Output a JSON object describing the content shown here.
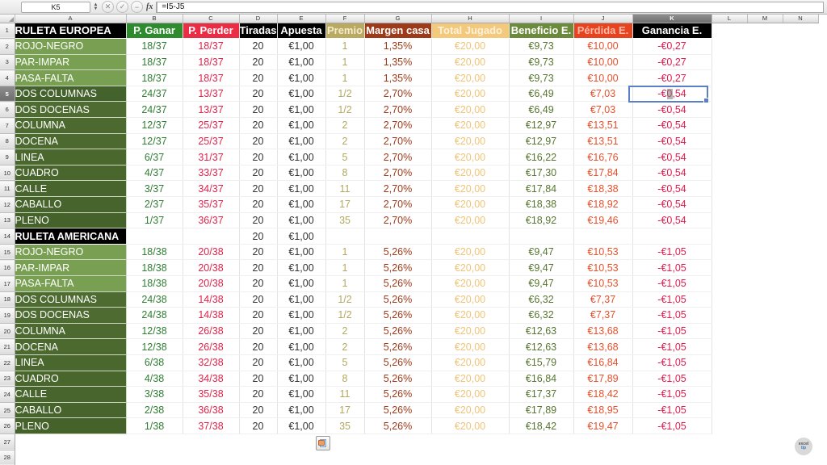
{
  "formula_bar": {
    "name_box_value": "K5",
    "formula_value": "=I5-J5",
    "cancel_icon": "cancel-icon",
    "accept_icon": "accept-icon",
    "function_icon": "function-icon",
    "fx_label": "fx"
  },
  "columns": {
    "letters": [
      "A",
      "B",
      "C",
      "D",
      "E",
      "F",
      "G",
      "H",
      "I",
      "J",
      "K",
      "L",
      "M",
      "N"
    ],
    "selected_letter": "K"
  },
  "rows": {
    "numbers": [
      "1",
      "2",
      "3",
      "4",
      "5",
      "6",
      "7",
      "8",
      "9",
      "10",
      "11",
      "12",
      "13",
      "14",
      "15",
      "16",
      "17",
      "18",
      "19",
      "20",
      "21",
      "22",
      "23",
      "24",
      "25",
      "26",
      "27",
      "28"
    ],
    "selected_number": "5"
  },
  "header": {
    "name": "RULETA EUROPEA",
    "p_ganar": "P. Ganar",
    "p_perder": "P. Perder",
    "tiradas": "Tiradas",
    "apuesta": "Apuesta",
    "premio": "Premio",
    "margen": "Margen casa",
    "total": "Total Jugado",
    "beneficio": "Beneficio E.",
    "perdida": "Pérdida E.",
    "ganancia": "Ganancia E."
  },
  "section_americana": {
    "title": "RULETA AMERICANA",
    "tiradas": "20",
    "apuesta": "€1,00"
  },
  "chart_data": {
    "type": "table",
    "title": "RULETA EUROPEA / RULETA AMERICANA",
    "columns": [
      "RULETA EUROPEA",
      "P. Ganar",
      "P. Perder",
      "Tiradas",
      "Apuesta",
      "Premio",
      "Margen casa",
      "Total Jugado",
      "Beneficio E.",
      "Pérdida E.",
      "Ganancia E."
    ],
    "europea": [
      {
        "row": "2",
        "name": "ROJO-NEGRO",
        "ganar": "18/37",
        "perder": "18/37",
        "tiradas": "20",
        "apuesta": "€1,00",
        "premio": "1",
        "margen": "1,35%",
        "total": "€20,00",
        "beneficio": "€9,73",
        "perdida": "€10,00",
        "ganancia": "-€0,27"
      },
      {
        "row": "3",
        "name": "PAR-IMPAR",
        "ganar": "18/37",
        "perder": "18/37",
        "tiradas": "20",
        "apuesta": "€1,00",
        "premio": "1",
        "margen": "1,35%",
        "total": "€20,00",
        "beneficio": "€9,73",
        "perdida": "€10,00",
        "ganancia": "-€0,27"
      },
      {
        "row": "4",
        "name": "PASA-FALTA",
        "ganar": "18/37",
        "perder": "18/37",
        "tiradas": "20",
        "apuesta": "€1,00",
        "premio": "1",
        "margen": "1,35%",
        "total": "€20,00",
        "beneficio": "€9,73",
        "perdida": "€10,00",
        "ganancia": "-€0,27"
      },
      {
        "row": "5",
        "name": "DOS COLUMNAS",
        "ganar": "24/37",
        "perder": "13/37",
        "tiradas": "20",
        "apuesta": "€1,00",
        "premio": "1/2",
        "margen": "2,70%",
        "total": "€20,00",
        "beneficio": "€6,49",
        "perdida": "€7,03",
        "ganancia": "-€0,54"
      },
      {
        "row": "6",
        "name": "DOS DOCENAS",
        "ganar": "24/37",
        "perder": "13/37",
        "tiradas": "20",
        "apuesta": "€1,00",
        "premio": "1/2",
        "margen": "2,70%",
        "total": "€20,00",
        "beneficio": "€6,49",
        "perdida": "€7,03",
        "ganancia": "-€0,54"
      },
      {
        "row": "7",
        "name": "COLUMNA",
        "ganar": "12/37",
        "perder": "25/37",
        "tiradas": "20",
        "apuesta": "€1,00",
        "premio": "2",
        "margen": "2,70%",
        "total": "€20,00",
        "beneficio": "€12,97",
        "perdida": "€13,51",
        "ganancia": "-€0,54"
      },
      {
        "row": "8",
        "name": "DOCENA",
        "ganar": "12/37",
        "perder": "25/37",
        "tiradas": "20",
        "apuesta": "€1,00",
        "premio": "2",
        "margen": "2,70%",
        "total": "€20,00",
        "beneficio": "€12,97",
        "perdida": "€13,51",
        "ganancia": "-€0,54"
      },
      {
        "row": "9",
        "name": "LINEA",
        "ganar": "6/37",
        "perder": "31/37",
        "tiradas": "20",
        "apuesta": "€1,00",
        "premio": "5",
        "margen": "2,70%",
        "total": "€20,00",
        "beneficio": "€16,22",
        "perdida": "€16,76",
        "ganancia": "-€0,54"
      },
      {
        "row": "10",
        "name": "CUADRO",
        "ganar": "4/37",
        "perder": "33/37",
        "tiradas": "20",
        "apuesta": "€1,00",
        "premio": "8",
        "margen": "2,70%",
        "total": "€20,00",
        "beneficio": "€17,30",
        "perdida": "€17,84",
        "ganancia": "-€0,54"
      },
      {
        "row": "11",
        "name": "CALLE",
        "ganar": "3/37",
        "perder": "34/37",
        "tiradas": "20",
        "apuesta": "€1,00",
        "premio": "11",
        "margen": "2,70%",
        "total": "€20,00",
        "beneficio": "€17,84",
        "perdida": "€18,38",
        "ganancia": "-€0,54"
      },
      {
        "row": "12",
        "name": "CABALLO",
        "ganar": "2/37",
        "perder": "35/37",
        "tiradas": "20",
        "apuesta": "€1,00",
        "premio": "17",
        "margen": "2,70%",
        "total": "€20,00",
        "beneficio": "€18,38",
        "perdida": "€18,92",
        "ganancia": "-€0,54"
      },
      {
        "row": "13",
        "name": "PLENO",
        "ganar": "1/37",
        "perder": "36/37",
        "tiradas": "20",
        "apuesta": "€1,00",
        "premio": "35",
        "margen": "2,70%",
        "total": "€20,00",
        "beneficio": "€18,92",
        "perdida": "€19,46",
        "ganancia": "-€0,54"
      }
    ],
    "americana": [
      {
        "row": "15",
        "name": "ROJO-NEGRO",
        "ganar": "18/38",
        "perder": "20/38",
        "tiradas": "20",
        "apuesta": "€1,00",
        "premio": "1",
        "margen": "5,26%",
        "total": "€20,00",
        "beneficio": "€9,47",
        "perdida": "€10,53",
        "ganancia": "-€1,05"
      },
      {
        "row": "16",
        "name": "PAR-IMPAR",
        "ganar": "18/38",
        "perder": "20/38",
        "tiradas": "20",
        "apuesta": "€1,00",
        "premio": "1",
        "margen": "5,26%",
        "total": "€20,00",
        "beneficio": "€9,47",
        "perdida": "€10,53",
        "ganancia": "-€1,05"
      },
      {
        "row": "17",
        "name": "PASA-FALTA",
        "ganar": "18/38",
        "perder": "20/38",
        "tiradas": "20",
        "apuesta": "€1,00",
        "premio": "1",
        "margen": "5,26%",
        "total": "€20,00",
        "beneficio": "€9,47",
        "perdida": "€10,53",
        "ganancia": "-€1,05"
      },
      {
        "row": "18",
        "name": "DOS COLUMNAS",
        "ganar": "24/38",
        "perder": "14/38",
        "tiradas": "20",
        "apuesta": "€1,00",
        "premio": "1/2",
        "margen": "5,26%",
        "total": "€20,00",
        "beneficio": "€6,32",
        "perdida": "€7,37",
        "ganancia": "-€1,05"
      },
      {
        "row": "19",
        "name": "DOS DOCENAS",
        "ganar": "24/38",
        "perder": "14/38",
        "tiradas": "20",
        "apuesta": "€1,00",
        "premio": "1/2",
        "margen": "5,26%",
        "total": "€20,00",
        "beneficio": "€6,32",
        "perdida": "€7,37",
        "ganancia": "-€1,05"
      },
      {
        "row": "20",
        "name": "COLUMNA",
        "ganar": "12/38",
        "perder": "26/38",
        "tiradas": "20",
        "apuesta": "€1,00",
        "premio": "2",
        "margen": "5,26%",
        "total": "€20,00",
        "beneficio": "€12,63",
        "perdida": "€13,68",
        "ganancia": "-€1,05"
      },
      {
        "row": "21",
        "name": "DOCENA",
        "ganar": "12/38",
        "perder": "26/38",
        "tiradas": "20",
        "apuesta": "€1,00",
        "premio": "2",
        "margen": "5,26%",
        "total": "€20,00",
        "beneficio": "€12,63",
        "perdida": "€13,68",
        "ganancia": "-€1,05"
      },
      {
        "row": "22",
        "name": "LINEA",
        "ganar": "6/38",
        "perder": "32/38",
        "tiradas": "20",
        "apuesta": "€1,00",
        "premio": "5",
        "margen": "5,26%",
        "total": "€20,00",
        "beneficio": "€15,79",
        "perdida": "€16,84",
        "ganancia": "-€1,05"
      },
      {
        "row": "23",
        "name": "CUADRO",
        "ganar": "4/38",
        "perder": "34/38",
        "tiradas": "20",
        "apuesta": "€1,00",
        "premio": "8",
        "margen": "5,26%",
        "total": "€20,00",
        "beneficio": "€16,84",
        "perdida": "€17,89",
        "ganancia": "-€1,05"
      },
      {
        "row": "24",
        "name": "CALLE",
        "ganar": "3/38",
        "perder": "35/38",
        "tiradas": "20",
        "apuesta": "€1,00",
        "premio": "11",
        "margen": "5,26%",
        "total": "€20,00",
        "beneficio": "€17,37",
        "perdida": "€18,42",
        "ganancia": "-€1,05"
      },
      {
        "row": "25",
        "name": "CABALLO",
        "ganar": "2/38",
        "perder": "36/38",
        "tiradas": "20",
        "apuesta": "€1,00",
        "premio": "17",
        "margen": "5,26%",
        "total": "€20,00",
        "beneficio": "€17,89",
        "perdida": "€18,95",
        "ganancia": "-€1,05"
      },
      {
        "row": "26",
        "name": "PLENO",
        "ganar": "1/38",
        "perder": "37/38",
        "tiradas": "20",
        "apuesta": "€1,00",
        "premio": "35",
        "margen": "5,26%",
        "total": "€20,00",
        "beneficio": "€18,42",
        "perdida": "€19,47",
        "ganancia": "-€1,05"
      }
    ]
  },
  "selection": {
    "cell": "K5",
    "value": "-€0,54"
  },
  "smart_tag": {
    "icon": "paste-options-icon"
  },
  "watermark": {
    "icon": "app-badge-icon",
    "line1": "excel",
    "line2": "tip"
  },
  "colors": {
    "green_header": "#2e8b2e",
    "red_header": "#ec2b45",
    "gold_header": "#b9a961",
    "brown_header": "#9c3a19",
    "orange_header": "#f3c97c",
    "olive_header": "#6c8a3c",
    "red_orange_header": "#e8431f",
    "black_header": "#000000",
    "selection_border": "#5b7fc7"
  }
}
